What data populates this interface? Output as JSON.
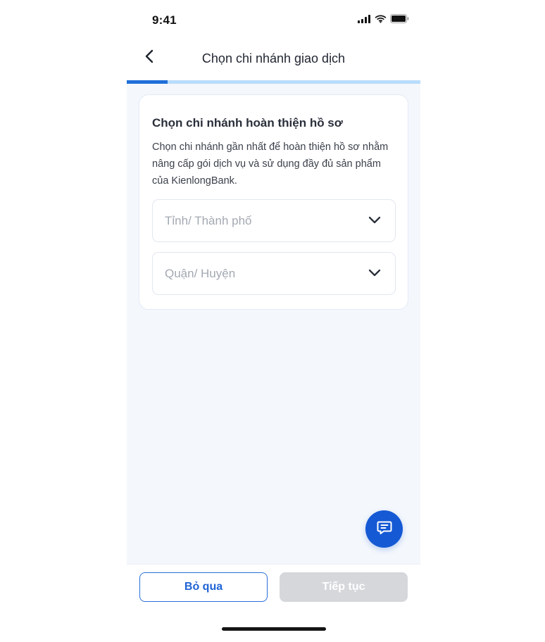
{
  "status_bar": {
    "time": "9:41",
    "icons": [
      "cellular-signal-icon",
      "wifi-icon",
      "battery-icon"
    ]
  },
  "header": {
    "title": "Chọn chi nhánh giao dịch",
    "back_icon": "chevron-left-icon"
  },
  "progress": {
    "value": 0.14,
    "track_color": "#b9dcfb",
    "fill_color": "#1f6fd8"
  },
  "card": {
    "title": "Chọn chi nhánh hoàn thiện hồ sơ",
    "description": "Chọn chi nhánh gần nhất để hoàn thiện hồ sơ nhằm nâng cấp gói dịch vụ và sử dụng đầy đủ sản phẩm của KienlongBank.",
    "province_select": {
      "placeholder": "Tỉnh/ Thành phố",
      "icon": "chevron-down-icon"
    },
    "district_select": {
      "placeholder": "Quận/ Huyện",
      "icon": "chevron-down-icon"
    }
  },
  "fab": {
    "icon": "chat-message-icon",
    "color": "#1559d4"
  },
  "footer": {
    "skip_label": "Bỏ qua",
    "continue_label": "Tiếp tục",
    "continue_disabled": true
  },
  "colors": {
    "accent": "#1f63d6",
    "background": "#f4f7fc",
    "disabled": "#d5d7db"
  }
}
